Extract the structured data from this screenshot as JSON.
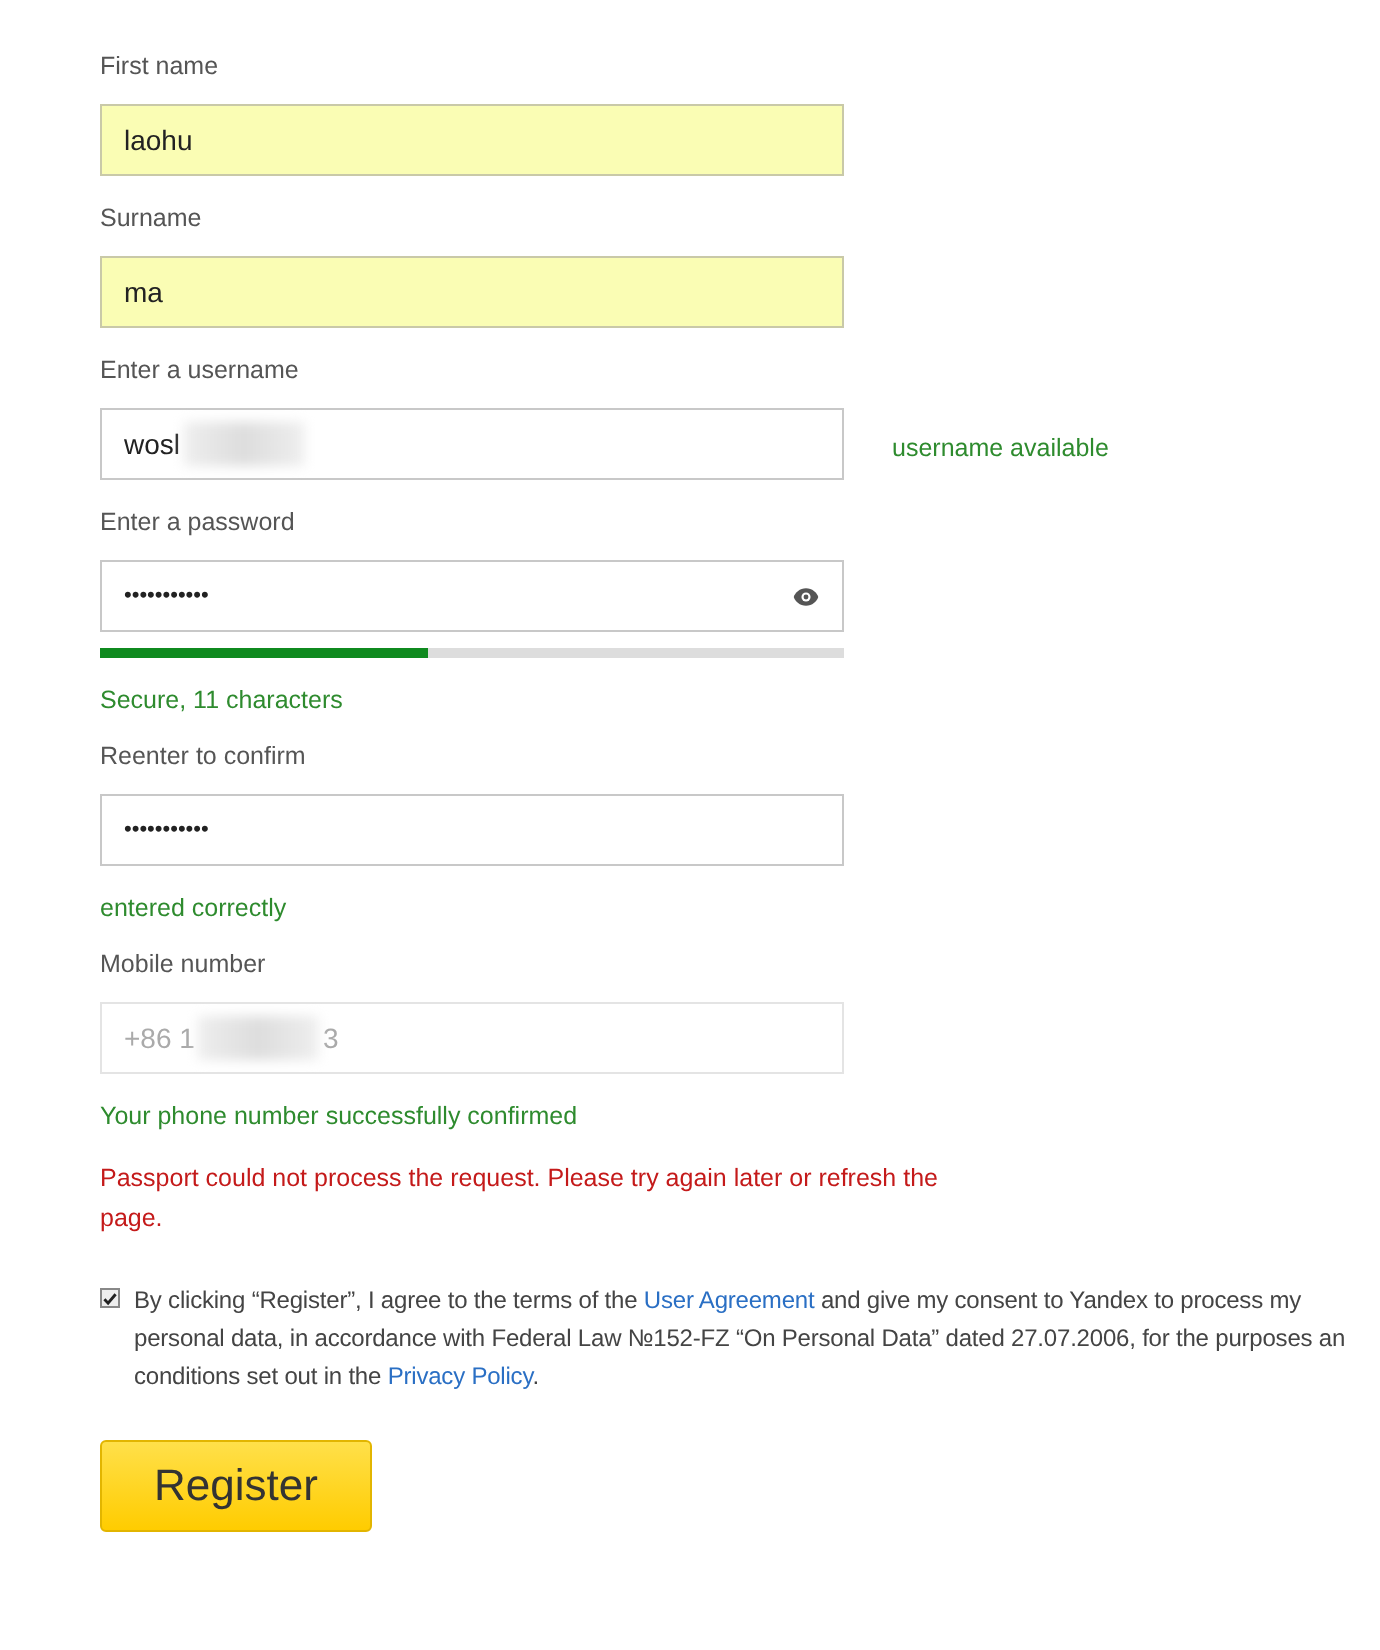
{
  "fields": [
    {
      "label": "First name",
      "kind": "text",
      "value": "laohu",
      "autofilled": true
    },
    {
      "label": "Surname",
      "kind": "text",
      "value": "ma",
      "autofilled": true
    },
    {
      "label": "Enter a username",
      "kind": "username",
      "value": "wosl",
      "redacted": true,
      "status": "username available",
      "autofilled": false
    },
    {
      "label": "Enter a password",
      "kind": "password",
      "value": "•••••••••••",
      "level": 0.44,
      "status": "Secure, 11 characters",
      "autofilled": false
    },
    {
      "label": "Reenter to confirm",
      "kind": "confirm",
      "value": "•••••••••••",
      "status": "entered correctly",
      "autofilled": false
    },
    {
      "label": "Mobile number",
      "kind": "phone",
      "value": "+86 1",
      "value_end": "3",
      "redacted": true,
      "disabled": true,
      "status": "Your phone number successfully confirmed",
      "autofilled": false
    }
  ],
  "error": "Passport could not process the request. Please try again later or refresh the page.",
  "consent": {
    "checked": true,
    "parts": [
      {
        "kind": "text",
        "text": "By clicking “Register”, I agree to the terms of the "
      },
      {
        "kind": "link",
        "text": "User Agreement"
      },
      {
        "kind": "text",
        "text": " and give my consent to Yandex to process my"
      },
      {
        "kind": "break"
      },
      {
        "kind": "text",
        "text": "personal data, in accordance with Federal Law №152-FZ “On Personal Data” dated 27.07.2006, for the purposes an"
      },
      {
        "kind": "break"
      },
      {
        "kind": "text",
        "text": "conditions set out in the "
      },
      {
        "kind": "link",
        "text": "Privacy Policy"
      },
      {
        "kind": "text",
        "text": "."
      }
    ]
  },
  "submit": {
    "label": "Register"
  }
}
